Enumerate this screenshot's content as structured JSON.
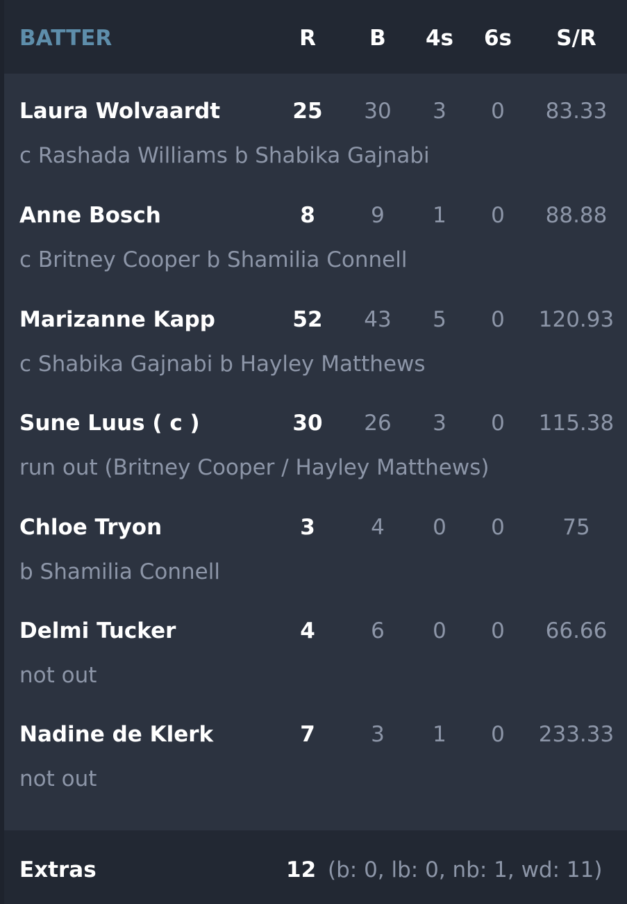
{
  "header": {
    "batter": "BATTER",
    "runs": "R",
    "balls": "B",
    "fours": "4s",
    "sixes": "6s",
    "strike_rate": "S/R"
  },
  "batters": [
    {
      "name": "Laura Wolvaardt",
      "dismissal": "c Rashada Williams b Shabika Gajnabi",
      "r": "25",
      "b": "30",
      "fours": "3",
      "sixes": "0",
      "sr": "83.33"
    },
    {
      "name": "Anne Bosch",
      "dismissal": "c Britney Cooper b Shamilia Connell",
      "r": "8",
      "b": "9",
      "fours": "1",
      "sixes": "0",
      "sr": "88.88"
    },
    {
      "name": "Marizanne Kapp",
      "dismissal": "c Shabika Gajnabi b Hayley Matthews",
      "r": "52",
      "b": "43",
      "fours": "5",
      "sixes": "0",
      "sr": "120.93"
    },
    {
      "name": "Sune Luus ( c )",
      "dismissal": "run out (Britney Cooper / Hayley Matthews)",
      "r": "30",
      "b": "26",
      "fours": "3",
      "sixes": "0",
      "sr": "115.38"
    },
    {
      "name": "Chloe Tryon",
      "dismissal": "b Shamilia Connell",
      "r": "3",
      "b": "4",
      "fours": "0",
      "sixes": "0",
      "sr": "75"
    },
    {
      "name": "Delmi Tucker",
      "dismissal": "not out",
      "r": "4",
      "b": "6",
      "fours": "0",
      "sixes": "0",
      "sr": "66.66"
    },
    {
      "name": "Nadine de Klerk",
      "dismissal": "not out",
      "r": "7",
      "b": "3",
      "fours": "1",
      "sixes": "0",
      "sr": "233.33"
    }
  ],
  "extras": {
    "label": "Extras",
    "total": "12",
    "detail": "(b: 0, lb: 0, nb: 1, wd: 11)"
  },
  "colors": {
    "background": "#2c3340",
    "header_background": "#222833",
    "batter_heading": "#5e8eab",
    "primary_text": "#ffffff",
    "secondary_text": "#8d96a8"
  }
}
